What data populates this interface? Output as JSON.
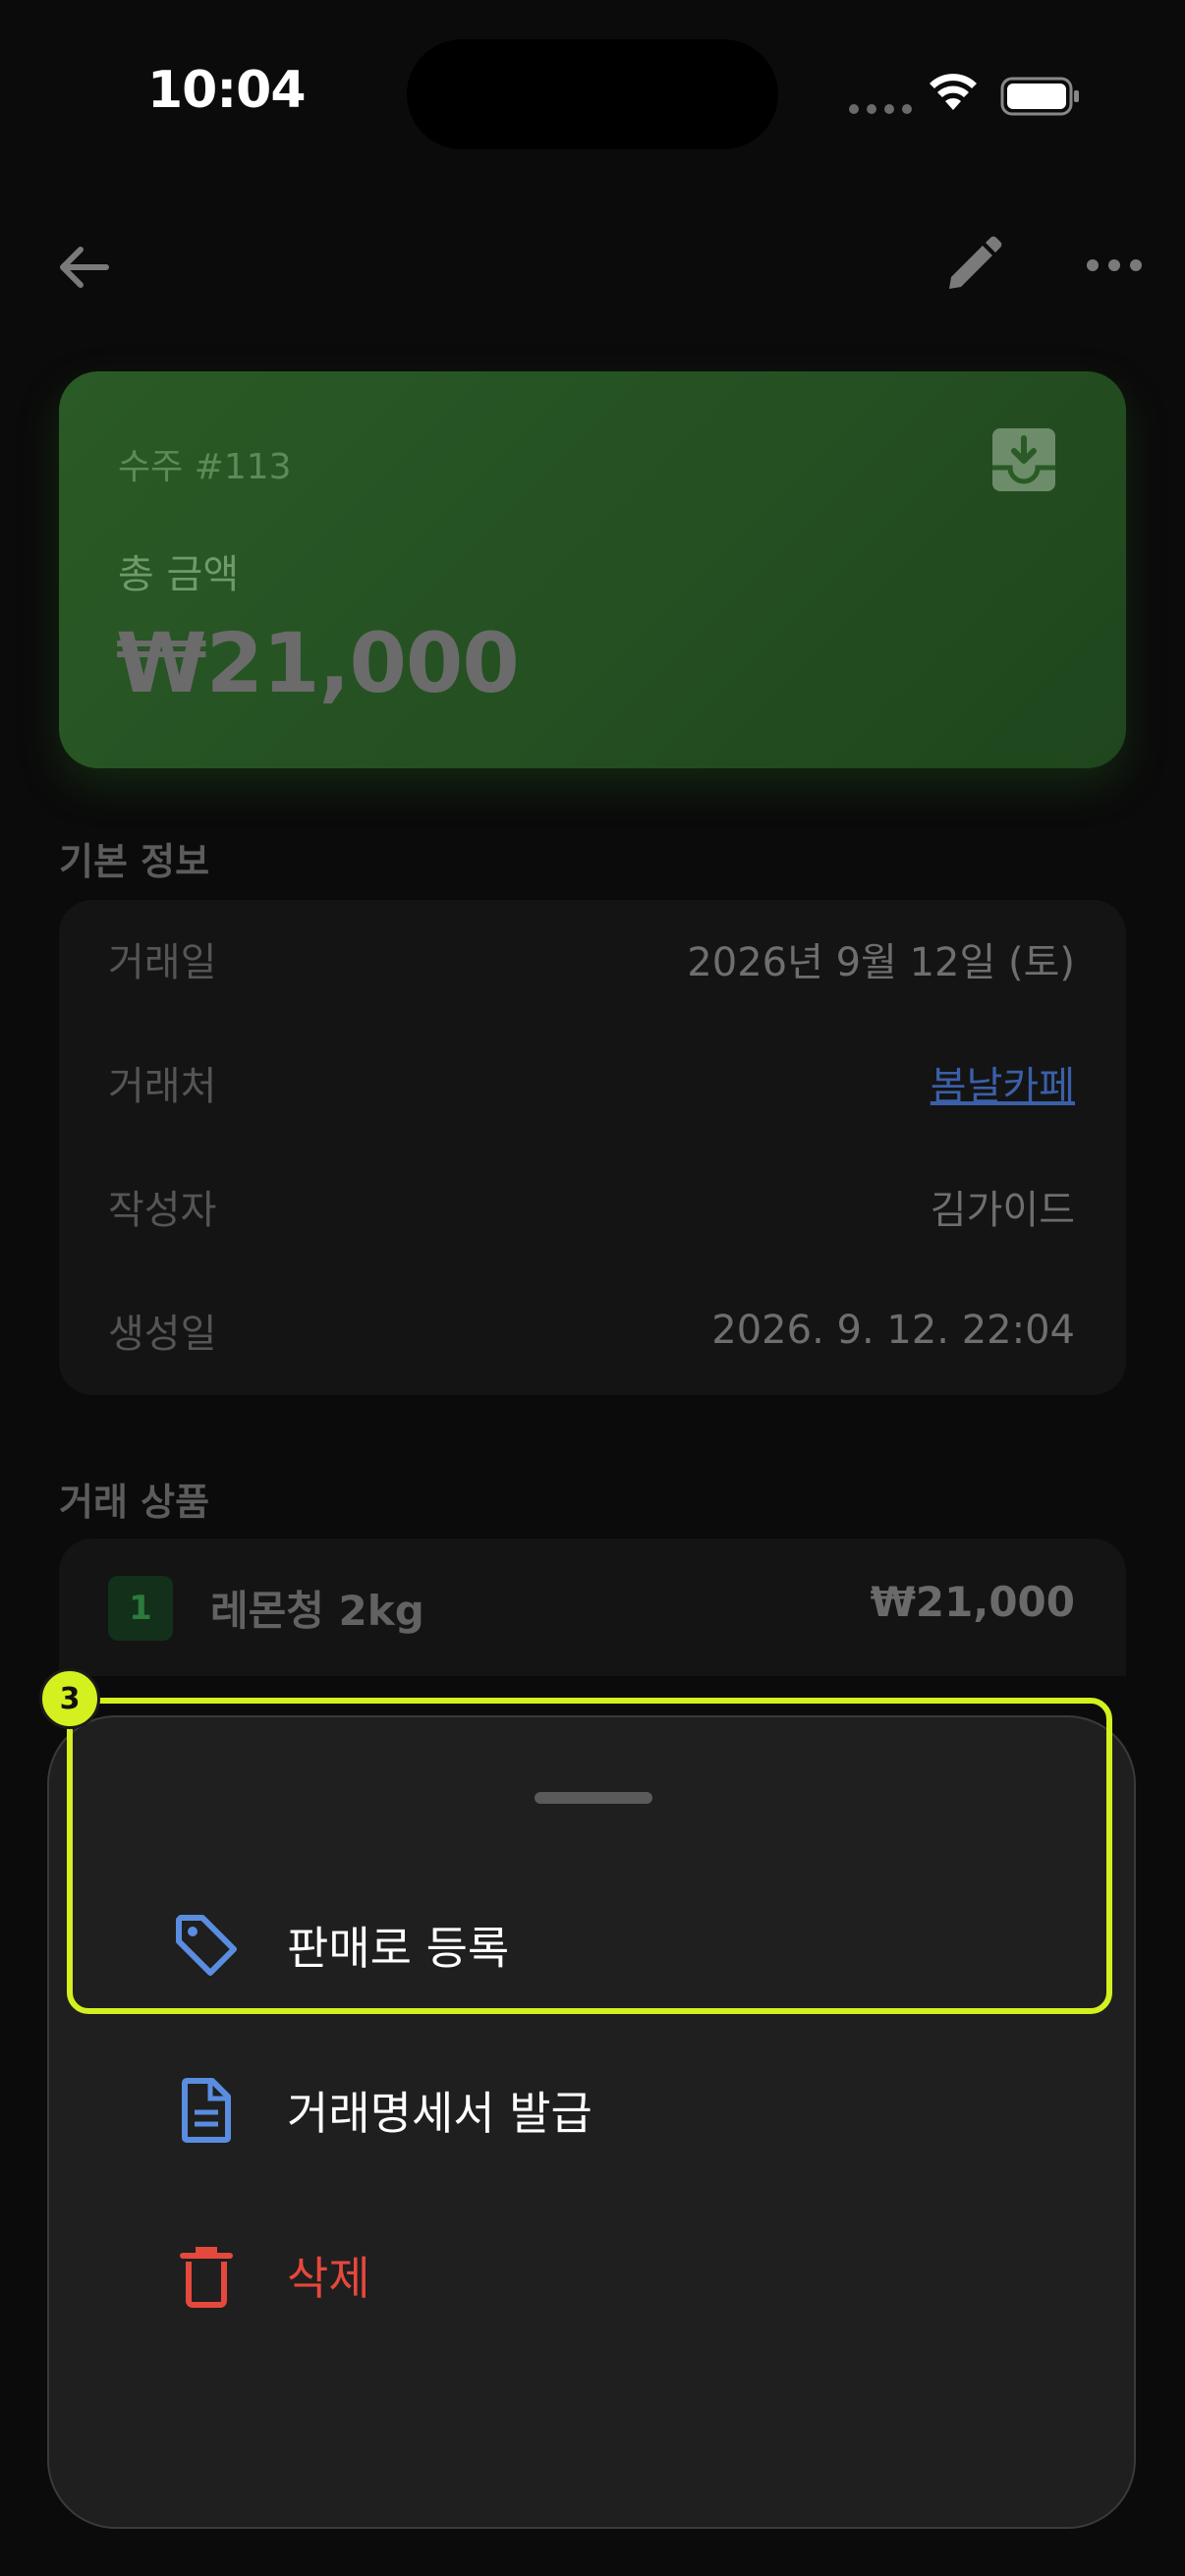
{
  "status_bar": {
    "time": "10:04"
  },
  "header": {
    "back_icon": "arrow-left-icon",
    "edit_icon": "pencil-icon",
    "more_icon": "more-horizontal-icon"
  },
  "total_card": {
    "order_number": "수주 #113",
    "total_label": "총 금액",
    "total_amount": "₩21,000",
    "download_icon": "download-tray-icon",
    "color": "#2a5a25"
  },
  "basic_info": {
    "title": "기본 정보",
    "rows": [
      {
        "key": "거래일",
        "value": "2026년 9월 12일 (토)"
      },
      {
        "key": "거래처",
        "value": "봄날카페"
      },
      {
        "key": "작성자",
        "value": "김가이드"
      },
      {
        "key": "생성일",
        "value": "2026. 9. 12. 22:04"
      }
    ]
  },
  "items": {
    "title": "거래 상품",
    "list": [
      {
        "index": "1",
        "name": "레몬청 2kg",
        "price": "₩21,000"
      }
    ]
  },
  "action_sheet": {
    "items": [
      {
        "label": "판매로 등록",
        "icon": "tag-icon",
        "color": "#5a8de0"
      },
      {
        "label": "거래명세서 발급",
        "icon": "document-icon",
        "color": "#5a8de0"
      },
      {
        "label": "삭제",
        "icon": "trash-icon",
        "color": "#e5483c"
      }
    ]
  },
  "annotation": {
    "badge": "3",
    "color": "#d4f01e"
  }
}
